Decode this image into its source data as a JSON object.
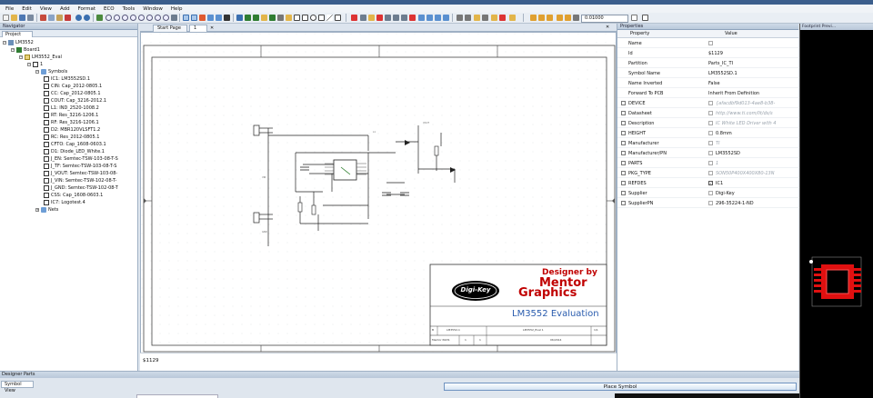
{
  "menu": [
    "File",
    "Edit",
    "View",
    "Add",
    "Format",
    "ECO",
    "Tools",
    "Window",
    "Help"
  ],
  "toolbar": {
    "zoom_value": "0.01000"
  },
  "navigator": {
    "title": "Navigator",
    "tab": "Project",
    "tree": [
      {
        "label": "LM3552",
        "level": 0,
        "icon": "project-icon"
      },
      {
        "label": "Board1",
        "level": 1,
        "icon": "board-icon"
      },
      {
        "label": "LM3552_Eval",
        "level": 2,
        "icon": "schematic-icon"
      },
      {
        "label": "1",
        "level": 3,
        "icon": "sheet-icon"
      },
      {
        "label": "Symbols",
        "level": 4,
        "icon": "folder-icon"
      },
      {
        "label": "IC1: LM3552SD.1",
        "level": 5,
        "icon": "symbol-icon"
      },
      {
        "label": "CIN: Cap_2012-0805.1",
        "level": 5,
        "icon": "symbol-icon"
      },
      {
        "label": "CC: Cap_2012-0805.1",
        "level": 5,
        "icon": "symbol-icon"
      },
      {
        "label": "COUT: Cap_3216-2012.1",
        "level": 5,
        "icon": "symbol-icon"
      },
      {
        "label": "L1: IND_2520-1008.2",
        "level": 5,
        "icon": "symbol-icon"
      },
      {
        "label": "RT: Res_3216-1206.1",
        "level": 5,
        "icon": "symbol-icon"
      },
      {
        "label": "RF: Res_3216-1206.1",
        "level": 5,
        "icon": "symbol-icon"
      },
      {
        "label": "D2: MBR120VLSFT1.2",
        "level": 5,
        "icon": "symbol-icon"
      },
      {
        "label": "RC: Res_2012-0805.1",
        "level": 5,
        "icon": "symbol-icon"
      },
      {
        "label": "CFTO: Cap_1608-0603.1",
        "level": 5,
        "icon": "symbol-icon"
      },
      {
        "label": "D1: Diode_LED_White.1",
        "level": 5,
        "icon": "symbol-icon"
      },
      {
        "label": "J_EN: Semtec-TSW-103-08-T-S",
        "level": 5,
        "icon": "symbol-icon"
      },
      {
        "label": "J_TF: Semtec-TSW-103-08-T-S",
        "level": 5,
        "icon": "symbol-icon"
      },
      {
        "label": "J_VOUT: Semtec-TSW-103-08-",
        "level": 5,
        "icon": "symbol-icon"
      },
      {
        "label": "J_VIN: Semtec-TSW-102-08-T-",
        "level": 5,
        "icon": "symbol-icon"
      },
      {
        "label": "J_GND: Semtec-TSW-102-08-T",
        "level": 5,
        "icon": "symbol-icon"
      },
      {
        "label": "CSS: Cap_1608-0603.1",
        "level": 5,
        "icon": "symbol-icon"
      },
      {
        "label": "IC7: Logotest.4",
        "level": 5,
        "icon": "symbol-icon"
      },
      {
        "label": "Nets",
        "level": 4,
        "icon": "folder-icon"
      }
    ]
  },
  "document": {
    "tabs": [
      "Start Page",
      "1"
    ],
    "status_text": "$1129",
    "title_block": {
      "designer_by": "Designer by",
      "logo_digikey": "Digi-Key",
      "logo_mentor_1": "Mentor",
      "logo_mentor_2": "Graphics",
      "title": "LM3552 Evaluation",
      "row1": [
        "B",
        "LM3552-1",
        "LM3552_Eval 1",
        "1/1"
      ],
      "row2": [
        "Mentor PADS",
        "1",
        "1",
        "06/2014"
      ]
    }
  },
  "properties": {
    "title": "Properties",
    "col_property": "Property",
    "col_value": "Value",
    "rows": [
      {
        "name": "Name",
        "value": "",
        "checkbox": false,
        "value_check": true,
        "dim": false
      },
      {
        "name": "Id",
        "value": "$1129",
        "checkbox": false,
        "value_check": false,
        "dim": false
      },
      {
        "name": "Partition",
        "value": "Parts_IC_TI",
        "checkbox": false,
        "value_check": false,
        "dim": false
      },
      {
        "name": "Symbol Name",
        "value": "LM3552SD.1",
        "checkbox": false,
        "value_check": false,
        "dim": false
      },
      {
        "name": "Name Inverted",
        "value": "False",
        "checkbox": false,
        "value_check": false,
        "dim": false
      },
      {
        "name": "Forward To PCB",
        "value": "Inherit From Definition",
        "checkbox": false,
        "value_check": false,
        "dim": false
      },
      {
        "name": "DEVICE",
        "value": "{afacdbf9d013-4ae8-b38-",
        "checkbox": true,
        "value_check": true,
        "dim": true
      },
      {
        "name": "Datasheet",
        "value": "http://www.ti.com/lit/ds/s",
        "checkbox": true,
        "value_check": true,
        "dim": true
      },
      {
        "name": "Description",
        "value": "IC White LED Driver with 4",
        "checkbox": true,
        "value_check": true,
        "dim": true
      },
      {
        "name": "HEIGHT",
        "value": "0.8mm",
        "checkbox": true,
        "value_check": true,
        "dim": false
      },
      {
        "name": "Manufacturer",
        "value": "TI",
        "checkbox": true,
        "value_check": true,
        "dim": true
      },
      {
        "name": "Manufacturer/PN",
        "value": "LM3552SD",
        "checkbox": true,
        "value_check": true,
        "dim": false
      },
      {
        "name": "PARTS",
        "value": "1",
        "checkbox": true,
        "value_check": true,
        "dim": true
      },
      {
        "name": "PKG_TYPE",
        "value": "SON50P400X400X80-13N",
        "checkbox": true,
        "value_check": true,
        "dim": true
      },
      {
        "name": "REFDES",
        "value": "IC1",
        "checkbox": true,
        "value_check": true,
        "dim": false,
        "checked": true
      },
      {
        "name": "Supplier",
        "value": "Digi-Key",
        "checkbox": true,
        "value_check": true,
        "dim": false
      },
      {
        "name": "SupplierPN",
        "value": "296-35224-1-ND",
        "checkbox": true,
        "value_check": true,
        "dim": false
      }
    ]
  },
  "footprint": {
    "title": "Footprint Previ..."
  },
  "bottom_panel": {
    "title": "Designer Parts",
    "tab": "Symbol View",
    "place_button": "Place Symbol"
  },
  "colors": {
    "accent": "#3b5e8c",
    "footprint_pad": "#e01010",
    "wire": "#1a1a1a"
  }
}
